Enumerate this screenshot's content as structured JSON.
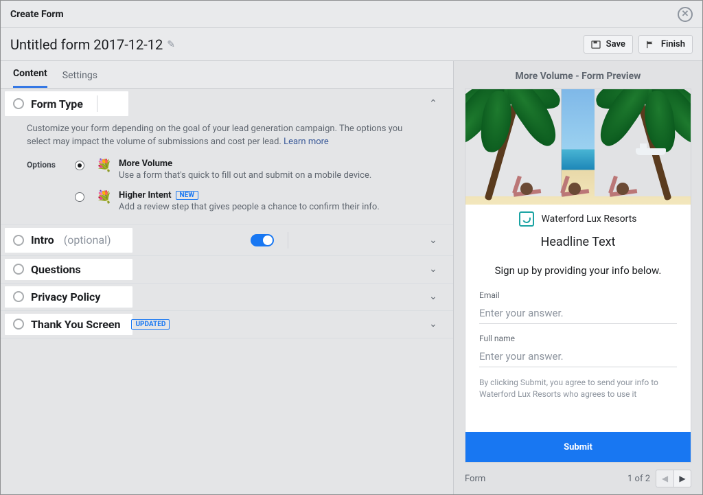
{
  "header": {
    "title": "Create Form",
    "form_name": "Untitled form 2017-12-12",
    "save_label": "Save",
    "finish_label": "Finish"
  },
  "tabs": {
    "content": "Content",
    "settings": "Settings"
  },
  "form_type": {
    "title": "Form Type",
    "desc_1": "Customize your form depending on the goal of your lead generation campaign. The options you select may impact the volume of submissions and cost per lead. ",
    "learn_more": "Learn more",
    "options_label": "Options",
    "more_volume": {
      "title": "More Volume",
      "desc": "Use a form that's quick to fill out and submit on a mobile device."
    },
    "higher_intent": {
      "title": "Higher Intent",
      "desc": "Add a review step that gives people a chance to confirm their info.",
      "badge": "NEW"
    }
  },
  "sections": {
    "intro": {
      "title": "Intro",
      "optional": "(optional)"
    },
    "questions": {
      "title": "Questions"
    },
    "privacy": {
      "title": "Privacy Policy"
    },
    "thankyou": {
      "title": "Thank You Screen",
      "badge": "UPDATED"
    }
  },
  "preview": {
    "title": "More Volume - Form Preview",
    "brand": "Waterford Lux Resorts",
    "headline": "Headline Text",
    "subline": "Sign up by providing your info below.",
    "fields": {
      "email": {
        "label": "Email",
        "placeholder": "Enter your answer."
      },
      "fullname": {
        "label": "Full name",
        "placeholder": "Enter your answer."
      }
    },
    "disclaimer": "By clicking Submit, you agree to send your info to Waterford Lux Resorts who agrees to use it",
    "submit": "Submit",
    "pager": {
      "label": "Form",
      "pos": "1 of 2"
    }
  }
}
